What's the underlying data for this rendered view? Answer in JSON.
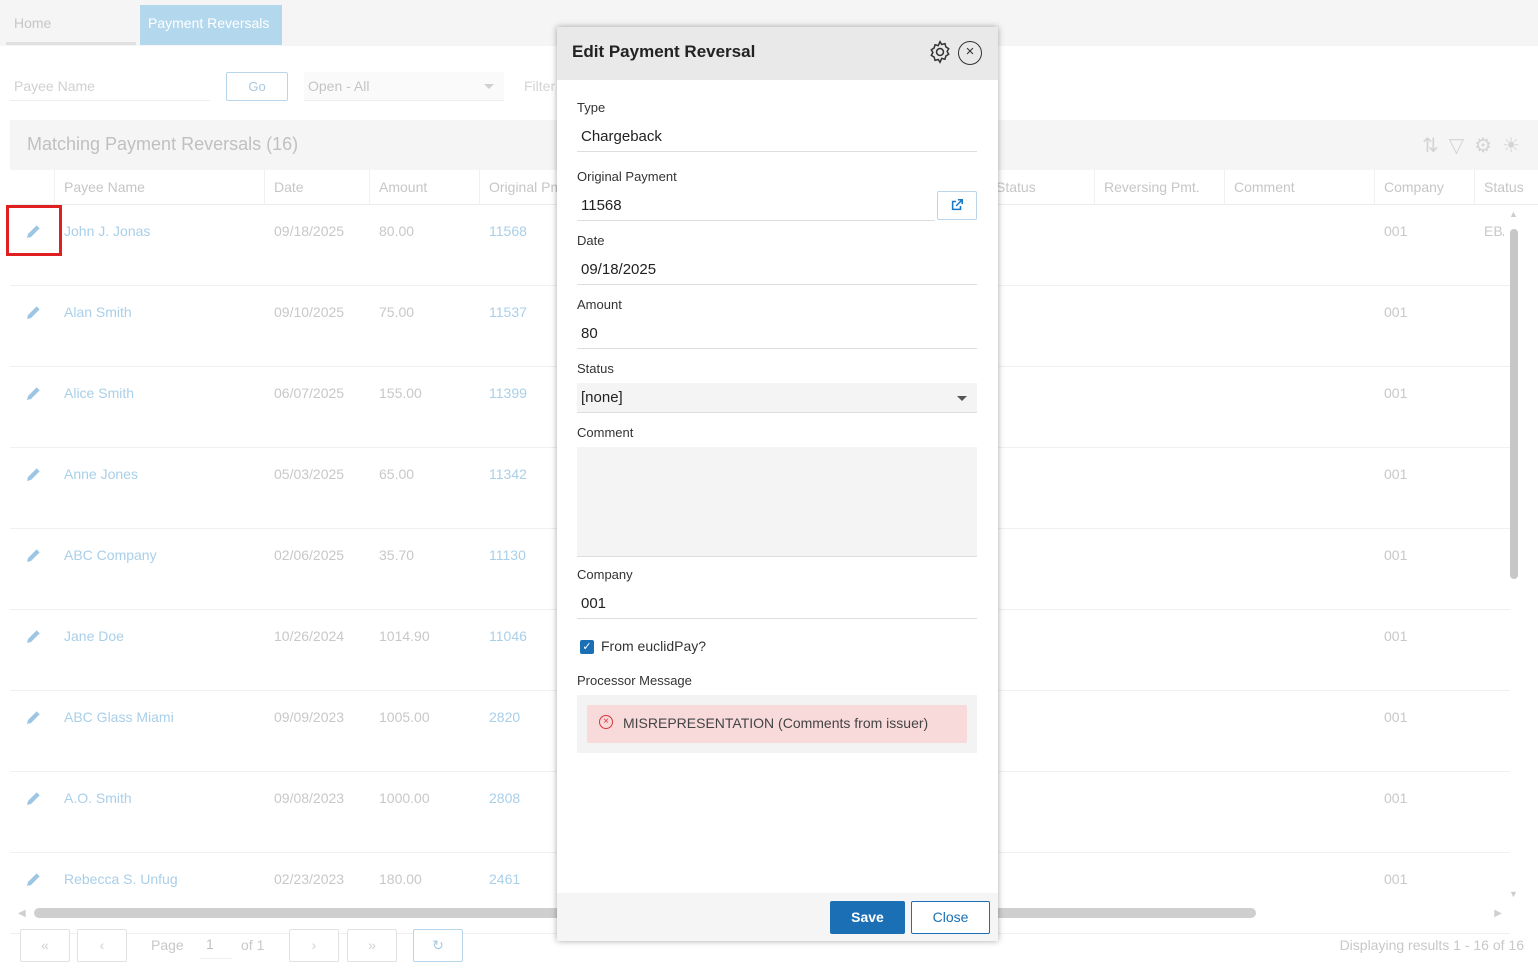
{
  "tabs": [
    {
      "label": "Home"
    },
    {
      "label": "Payment Reversals"
    }
  ],
  "filters": {
    "payee_placeholder": "Payee Name",
    "go_label": "Go",
    "status_value": "Open - All",
    "filter_placeholder": "Filter"
  },
  "grid": {
    "title": "Matching Payment Reversals (16)",
    "columns": [
      "Payee Name",
      "Date",
      "Amount",
      "Original Pmt",
      "Status",
      "Reversing Pmt.",
      "Comment",
      "Company",
      "Status"
    ],
    "rows": [
      {
        "payee": "John J. Jonas",
        "date": "09/18/2025",
        "amount": "80.00",
        "orig": "11568",
        "company": "001",
        "status2": "EBA"
      },
      {
        "payee": "Alan Smith",
        "date": "09/10/2025",
        "amount": "75.00",
        "orig": "11537",
        "company": "001",
        "status2": ""
      },
      {
        "payee": "Alice Smith",
        "date": "06/07/2025",
        "amount": "155.00",
        "orig": "11399",
        "company": "001",
        "status2": ""
      },
      {
        "payee": "Anne Jones",
        "date": "05/03/2025",
        "amount": "65.00",
        "orig": "11342",
        "company": "001",
        "status2": ""
      },
      {
        "payee": "ABC Company",
        "date": "02/06/2025",
        "amount": "35.70",
        "orig": "11130",
        "company": "001",
        "status2": ""
      },
      {
        "payee": "Jane Doe",
        "date": "10/26/2024",
        "amount": "1014.90",
        "orig": "11046",
        "company": "001",
        "status2": ""
      },
      {
        "payee": "ABC Glass Miami",
        "date": "09/09/2023",
        "amount": "1005.00",
        "orig": "2820",
        "company": "001",
        "status2": ""
      },
      {
        "payee": "A.O. Smith",
        "date": "09/08/2023",
        "amount": "1000.00",
        "orig": "2808",
        "company": "001",
        "status2": ""
      },
      {
        "payee": "Rebecca S. Unfug",
        "date": "02/23/2023",
        "amount": "180.00",
        "orig": "2461",
        "company": "001",
        "status2": ""
      }
    ]
  },
  "pager": {
    "page_label": "Page",
    "page_value": "1",
    "of_label": "of 1",
    "results": "Displaying results 1 - 16 of 16"
  },
  "dialog": {
    "title": "Edit Payment Reversal",
    "type_label": "Type",
    "type_value": "Chargeback",
    "orig_label": "Original Payment",
    "orig_value": "11568",
    "date_label": "Date",
    "date_value": "09/18/2025",
    "amount_label": "Amount",
    "amount_value": "80",
    "status_label": "Status",
    "status_value": "[none]",
    "comment_label": "Comment",
    "comment_value": "",
    "company_label": "Company",
    "company_value": "001",
    "euclid_label": "From euclidPay?",
    "euclid_checked": true,
    "proc_label": "Processor Message",
    "proc_message": "MISREPRESENTATION (Comments from issuer)",
    "save_label": "Save",
    "close_label": "Close"
  },
  "colors": {
    "accent": "#1a6fb5",
    "error_bg": "#f9dadb",
    "error_icon": "#d9353c",
    "highlight": "#e02020"
  }
}
